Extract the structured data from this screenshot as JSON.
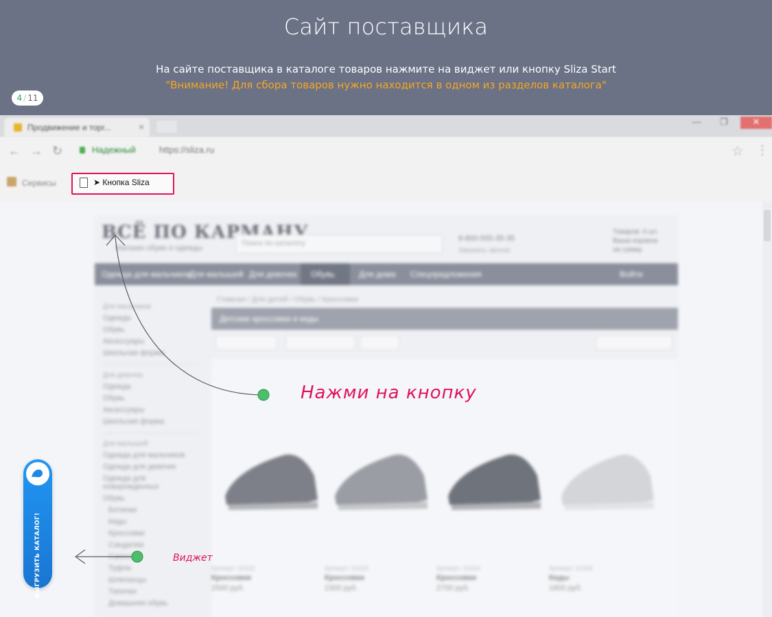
{
  "header": {
    "title": "Сайт поставщика",
    "instruction": "На сайте поставщика в каталоге товаров нажмите на виджет или кнопку Sliza Start",
    "warning": "\"Внимание! Для сбора товаров нужно находится в одном из разделов каталога\"",
    "step": {
      "current": "4",
      "separator": "/",
      "total": "11"
    }
  },
  "browser": {
    "tab_title": "Продвижение и торг...",
    "tab_close": "×",
    "window_buttons": {
      "minimize": "—",
      "maximize": "❐",
      "close": "✕"
    },
    "nav_back": "←",
    "nav_forward": "→",
    "nav_reload": "↻",
    "secure_label": "Надежный",
    "url": "https://sliza.ru",
    "bookmark_star": "☆",
    "menu_icon": "⋮",
    "bookmarks": {
      "services_label": "Сервисы",
      "sliza_button_label": "➤ Кнопка Sliza"
    }
  },
  "site": {
    "logo": "ВСЁ ПО КАРМАНУ",
    "logo_sub": "Магазин обуви и одежды",
    "search_placeholder": "Поиск по каталогу",
    "phone": "8-800-555-35-35",
    "phone_sub": "Заказать звонок",
    "cart_lines": [
      "Товаров: 0 шт.",
      "Ваша корзина",
      "на сумму"
    ],
    "nav": [
      "Одежда для мальчиков",
      "Для малышей",
      "Для девочек",
      "Обувь",
      "Для дома",
      "Спецпредложения",
      "Войти"
    ],
    "breadcrumbs": "Главная / Для детей / Обувь / Кроссовки",
    "category_title": "Детские кроссовки и кеды",
    "left_groups": [
      {
        "title": "Для мальчиков",
        "items": [
          "Одежда",
          "Обувь",
          "Аксессуары",
          "Школьная форма"
        ]
      },
      {
        "title": "Для девочек",
        "items": [
          "Одежда",
          "Обувь",
          "Аксессуары",
          "Школьная форма"
        ]
      },
      {
        "title": "Для малышей",
        "items": [
          "Одежда для мальчиков",
          "Одежда для девочек",
          "Одежда для новорожденных",
          "Обувь",
          "Ботинки",
          "Кеды",
          "Кроссовки",
          "Сандалии",
          "Сапоги",
          "Туфли",
          "Шлепанцы",
          "Тапочки",
          "Домашняя обувь"
        ]
      }
    ],
    "products": [
      {
        "article": "Артикул: 10152",
        "name": "Кроссовки",
        "price": "2500 руб."
      },
      {
        "article": "Артикул: 10153",
        "name": "Кроссовки",
        "price": "2300 руб."
      },
      {
        "article": "Артикул: 10154",
        "name": "Кроссовки",
        "price": "2700 руб."
      },
      {
        "article": "Артикул: 10155",
        "name": "Кеды",
        "price": "1800 руб."
      }
    ]
  },
  "annotations": {
    "button_callout": "Нажми на кнопку",
    "widget_callout": "Виджет"
  },
  "widget": {
    "label": "ВЫГРУЗИТЬ КАТАЛОГ!"
  },
  "colors": {
    "header_bg": "#6b7286",
    "warning": "#f6a623",
    "accent_pink": "#e0115f",
    "dot_green": "#4cbf6a",
    "widget_blue": "#1e88e5"
  }
}
